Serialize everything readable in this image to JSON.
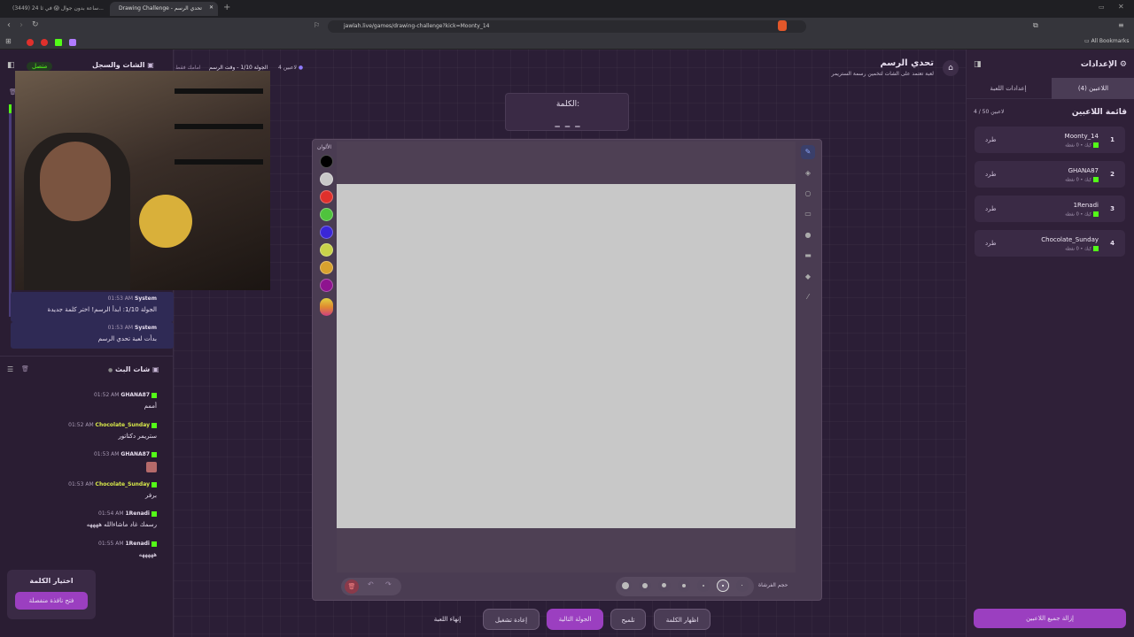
{
  "browser": {
    "tabs": [
      {
        "label": "(3449) 24 ساعة بدون جوال 😱 في ثا..."
      },
      {
        "label": "Drawing Challenge - تحدي الرسم"
      }
    ],
    "url": "jawlah.live/games/drawing-challenge?kick=Moonty_14",
    "bookmarks_label": "All Bookmarks"
  },
  "chat": {
    "title": "الشات والسجل",
    "status": "متصل",
    "system_messages": [
      {
        "sender": "System",
        "time": "01:53 AM",
        "text": "الجولة 1/10: ابدأ الرسم! اختر كلمة جديدة"
      },
      {
        "sender": "System",
        "time": "01:53 AM",
        "text": "بدأت لعبة تحدي الرسم"
      }
    ],
    "live_title": "شات البث",
    "messages": [
      {
        "user": "GHANA87",
        "time": "01:52 AM",
        "text": "أممم"
      },
      {
        "user": "Chocolate_Sunday",
        "time": "01:52 AM",
        "text": "ستريمر دكتاتور"
      },
      {
        "user": "GHANA87",
        "time": "01:53 AM",
        "text": ""
      },
      {
        "user": "Chocolate_Sunday",
        "time": "01:53 AM",
        "text": "برفر"
      },
      {
        "user": "1Renadi",
        "time": "01:54 AM",
        "text": "رسمك غاد ماشاءالله ههههه"
      },
      {
        "user": "1Renadi",
        "time": "01:55 AM",
        "text": "هههههه"
      }
    ]
  },
  "word_choice": {
    "title": "اختيار الكلمة",
    "button": "فتح نافذة منفصلة"
  },
  "header": {
    "title": "تحدي الرسم",
    "subtitle": "لعبة تعتمد على الشات لتخمين رسمة الستريمر",
    "players_count": "4 لاعبين",
    "round_info": "الجولة 1/10 - وقت الرسم",
    "mode": "امامك فقط"
  },
  "word_box": {
    "label": "الكلمة:",
    "value": "_ _ _"
  },
  "canvas": {
    "colors_label": "الألوان",
    "colors": [
      "#000000",
      "#c8c8c8",
      "#e0302c",
      "#4fc33d",
      "#3a26d8",
      "#c8d24a",
      "#d8a22e",
      "#8e138f"
    ],
    "brush_label": "حجم الفرشاة"
  },
  "controls": {
    "end_game": "إنهاء اللعبة",
    "restart": "إعادة تشغيل",
    "next_round": "الجولة التالية",
    "hint": "تلميح",
    "reveal_word": "اظهار الكلمة"
  },
  "settings": {
    "title": "الإعدادات",
    "tab_players": "اللاعبين (4)",
    "tab_game": "إعدادات اللعبة",
    "list_title": "قائمة اللاعبين",
    "capacity": "4 / 50 لاعبين",
    "kick_label": "طرد",
    "players": [
      {
        "rank": "1",
        "name": "Moonty_14",
        "meta": "كيك • 0 نقطة"
      },
      {
        "rank": "2",
        "name": "GHANA87",
        "meta": "كيك • 0 نقطة"
      },
      {
        "rank": "3",
        "name": "1Renadi",
        "meta": "كيك • 0 نقطة"
      },
      {
        "rank": "4",
        "name": "Chocolate_Sunday",
        "meta": "كيك • 0 نقطة"
      }
    ],
    "remove_all": "إزالة جميع اللاعبين"
  }
}
